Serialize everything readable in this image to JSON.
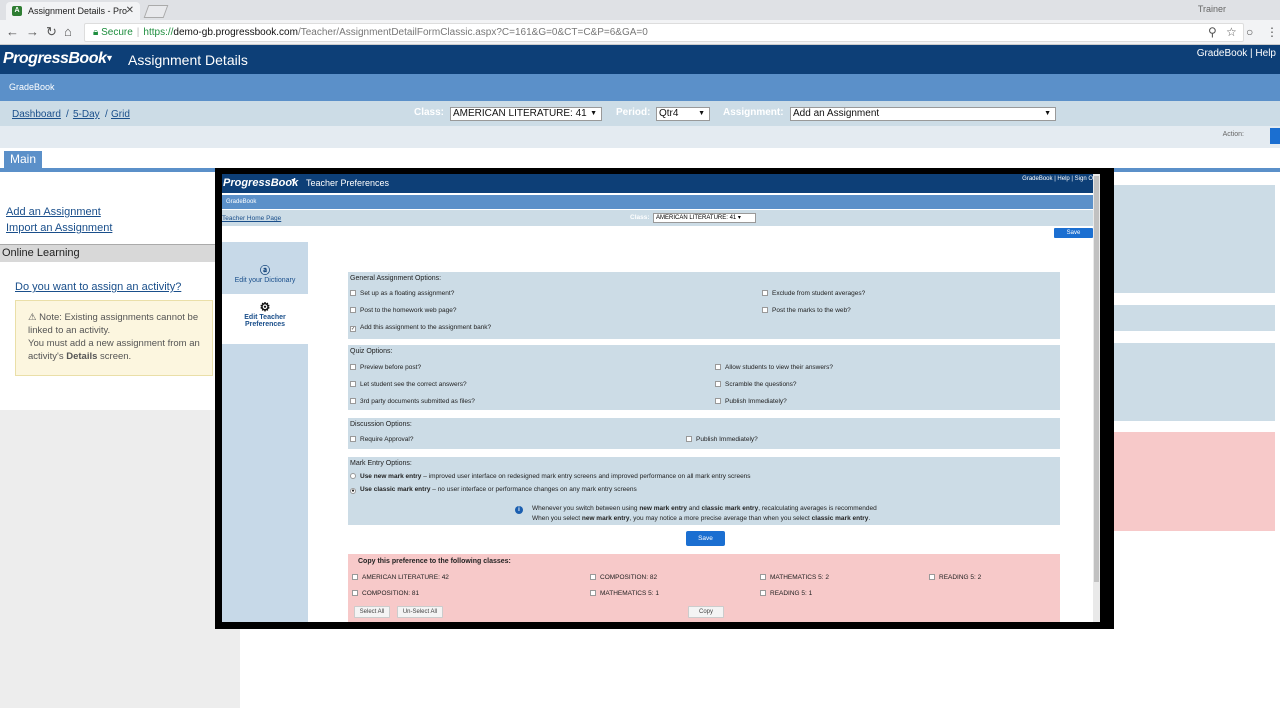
{
  "browser": {
    "tab_title": "Assignment Details - Pro",
    "favicon_text": "A",
    "user": "Trainer",
    "secure_label": "Secure",
    "url_scheme": "https://",
    "url_host": "demo-gb.progressbook.com",
    "url_path": "/Teacher/AssignmentDetailFormClassic.aspx?C=161&G=0&CT=C&P=6&GA=0"
  },
  "header": {
    "logo": "ProgressBook",
    "title": "Assignment Details",
    "links": "GradeBook | Help"
  },
  "subheader": {
    "label": "GradeBook"
  },
  "breadcrumb": {
    "dashboard": "Dashboard",
    "five_day": "5-Day",
    "grid": "Grid"
  },
  "filters": {
    "class_label": "Class:",
    "class_value": "AMERICAN LITERATURE: 41",
    "period_label": "Period:",
    "period_value": "Qtr4",
    "assignment_label": "Assignment:",
    "assignment_value": "Add an Assignment"
  },
  "action_label": "Action:",
  "main_tab": "Main",
  "left_panel": {
    "add_assignment": "Add an Assignment",
    "import_assignment": "Import an Assignment",
    "online_learning": "Online Learning",
    "assign_question": "Do you want to assign an activity?",
    "note_line1": "Note: Existing assignments cannot be linked to an activity.",
    "note_line2_pre": "You must add a new assignment from an activity's ",
    "note_bold": "Details",
    "note_line2_post": " screen."
  },
  "modal": {
    "logo": "ProgressBook",
    "title": "Teacher Preferences",
    "links": "GradeBook | Help | Sign Out",
    "sub": "GradeBook",
    "home_link": "Teacher Home Page",
    "class_label": "Class:",
    "class_value": "AMERICAN LITERATURE: 41",
    "save_label": "Save",
    "side": {
      "dictionary": "Edit your Dictionary",
      "preferences": "Edit Teacher Preferences"
    },
    "general": {
      "title": "General Assignment Options:",
      "opt1": "Set up as a floating assignment?",
      "opt2": "Post to the homework web page?",
      "opt3": "Add this assignment to the assignment bank?",
      "opt4": "Exclude from student averages?",
      "opt5": "Post the marks to the web?"
    },
    "quiz": {
      "title": "Quiz Options:",
      "opt1": "Preview before post?",
      "opt2": "Let student see the correct answers?",
      "opt3": "3rd party documents submitted as files?",
      "opt4": "Allow students to view their answers?",
      "opt5": "Scramble the questions?",
      "opt6": "Publish Immediately?"
    },
    "discussion": {
      "title": "Discussion Options:",
      "opt1": "Require Approval?",
      "opt2": "Publish Immediately?"
    },
    "mark_entry": {
      "title": "Mark Entry Options:",
      "new_bold": "Use new mark entry",
      "new_rest": " – improved user interface on redesigned mark entry screens and improved performance on all mark entry screens",
      "classic_bold": "Use classic mark entry",
      "classic_rest": " – no user interface or performance changes on any mark entry screens",
      "info1_pre": "Whenever you switch between using ",
      "info1_b1": "new mark entry",
      "info1_mid": " and ",
      "info1_b2": "classic mark entry",
      "info1_post": ", recalculating averages is recommended",
      "info2_pre": "When you select ",
      "info2_b1": "new mark entry",
      "info2_mid": ", you may notice a more precise average than when you select ",
      "info2_b2": "classic mark entry",
      "info2_post": "."
    },
    "copy": {
      "title": "Copy this preference to the following classes:",
      "classes": [
        "AMERICAN LITERATURE: 42",
        "COMPOSITION: 82",
        "MATHEMATICS 5: 2",
        "READING 5: 2",
        "COMPOSITION: 81",
        "MATHEMATICS 5: 1",
        "READING 5: 1"
      ],
      "select_all": "Select All",
      "unselect_all": "Un-Select All",
      "copy_btn": "Copy"
    }
  }
}
